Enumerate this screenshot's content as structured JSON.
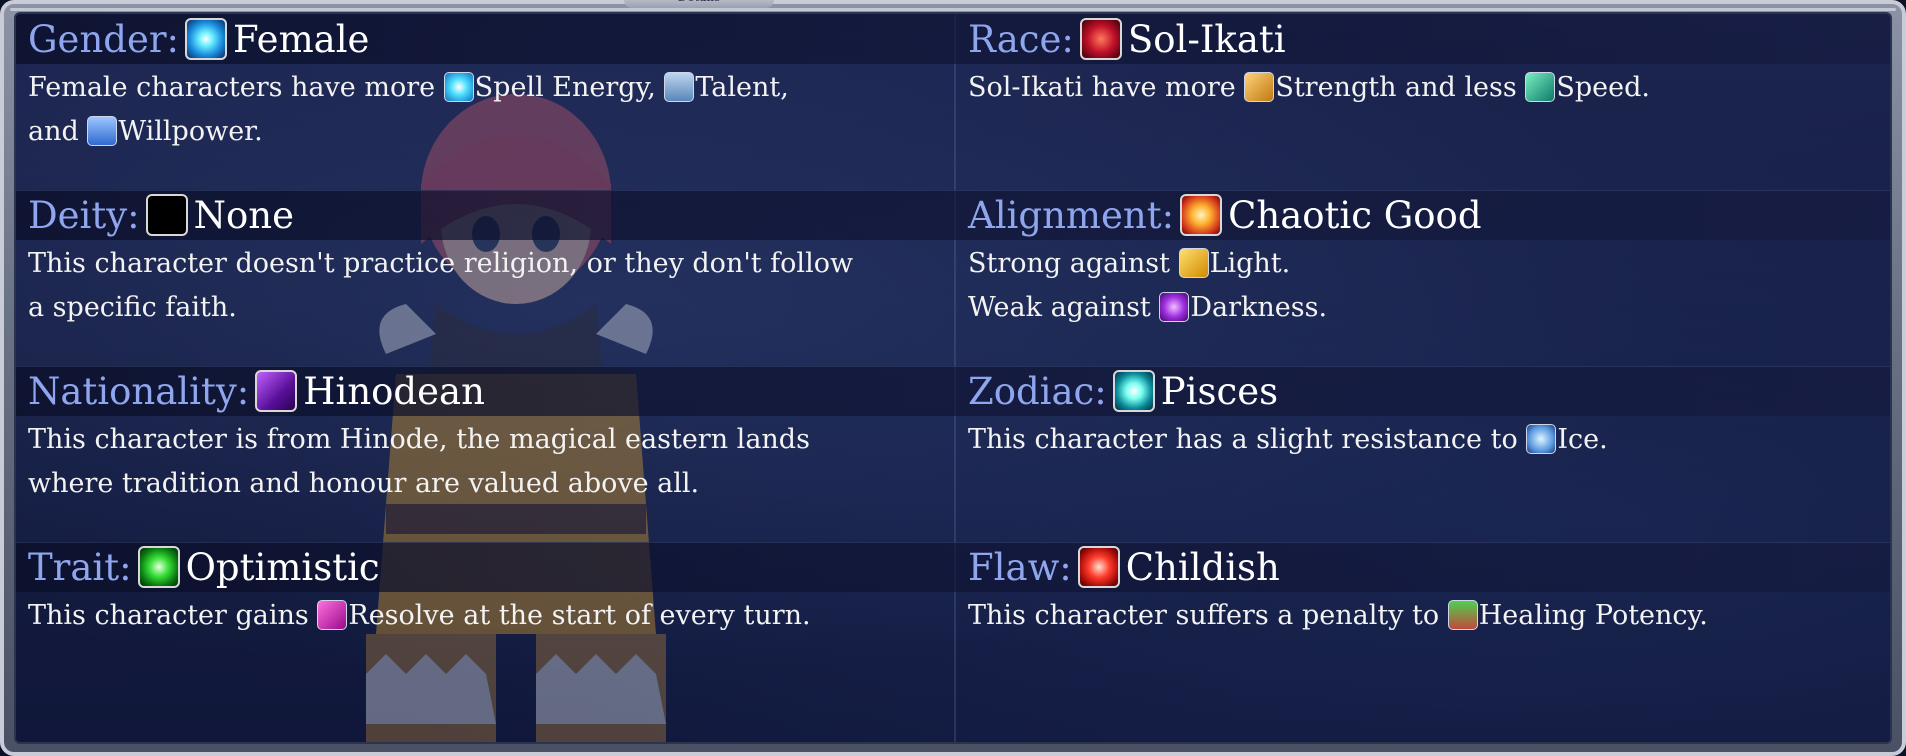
{
  "panel_title": "Details",
  "cells": {
    "gender": {
      "label": "Gender:",
      "value": "Female",
      "desc": {
        "a": "Female characters have more ",
        "s1": "Spell Energy, ",
        "s2": "Talent,",
        "b": "and ",
        "s3": "Willpower."
      }
    },
    "race": {
      "label": "Race:",
      "value": "Sol-Ikati",
      "desc": {
        "a": "Sol-Ikati have more ",
        "s1": "Strength and less ",
        "s2": "Speed."
      }
    },
    "deity": {
      "label": "Deity:",
      "value": "None",
      "desc": {
        "line1": "This character doesn't practice religion, or they don't follow",
        "line2": "a specific faith."
      }
    },
    "alignment": {
      "label": "Alignment:",
      "value": "Chaotic Good",
      "desc": {
        "a": "Strong against ",
        "s1": "Light.",
        "b": "Weak against ",
        "s2": "Darkness."
      }
    },
    "nationality": {
      "label": "Nationality:",
      "value": "Hinodean",
      "desc": {
        "line1": "This character is from Hinode, the magical eastern lands",
        "line2": "where tradition and honour are valued above all."
      }
    },
    "zodiac": {
      "label": "Zodiac:",
      "value": "Pisces",
      "desc": {
        "a": "This character has a slight resistance to ",
        "s1": "Ice."
      }
    },
    "trait": {
      "label": "Trait:",
      "value": "Optimistic",
      "desc": {
        "a": "This character gains ",
        "s1": "Resolve at the start of every turn."
      }
    },
    "flaw": {
      "label": "Flaw:",
      "value": "Childish",
      "desc": {
        "a": "This character suffers a penalty to ",
        "s1": "Healing Potency."
      }
    }
  },
  "icons": {
    "gender": "blue-orb-icon",
    "race": "red-race-emblem-icon",
    "deity": "black-none-icon",
    "alignment": "chaotic-good-sun-icon",
    "nationality": "purple-hinode-icon",
    "zodiac": "pisces-star-icon",
    "trait": "green-orb-icon",
    "flaw": "red-flame-icon",
    "spell_energy": "spell-energy-icon",
    "talent": "talent-icon",
    "willpower": "willpower-shield-icon",
    "strength": "strength-icon",
    "speed": "speed-icon",
    "light": "light-icon",
    "darkness": "darkness-eye-icon",
    "ice": "ice-icon",
    "resolve": "resolve-icon",
    "healing": "healing-potency-icon"
  },
  "colors": {
    "label": "#8fa6ee",
    "value": "#ffffff",
    "desc": "#f3f3f3"
  }
}
